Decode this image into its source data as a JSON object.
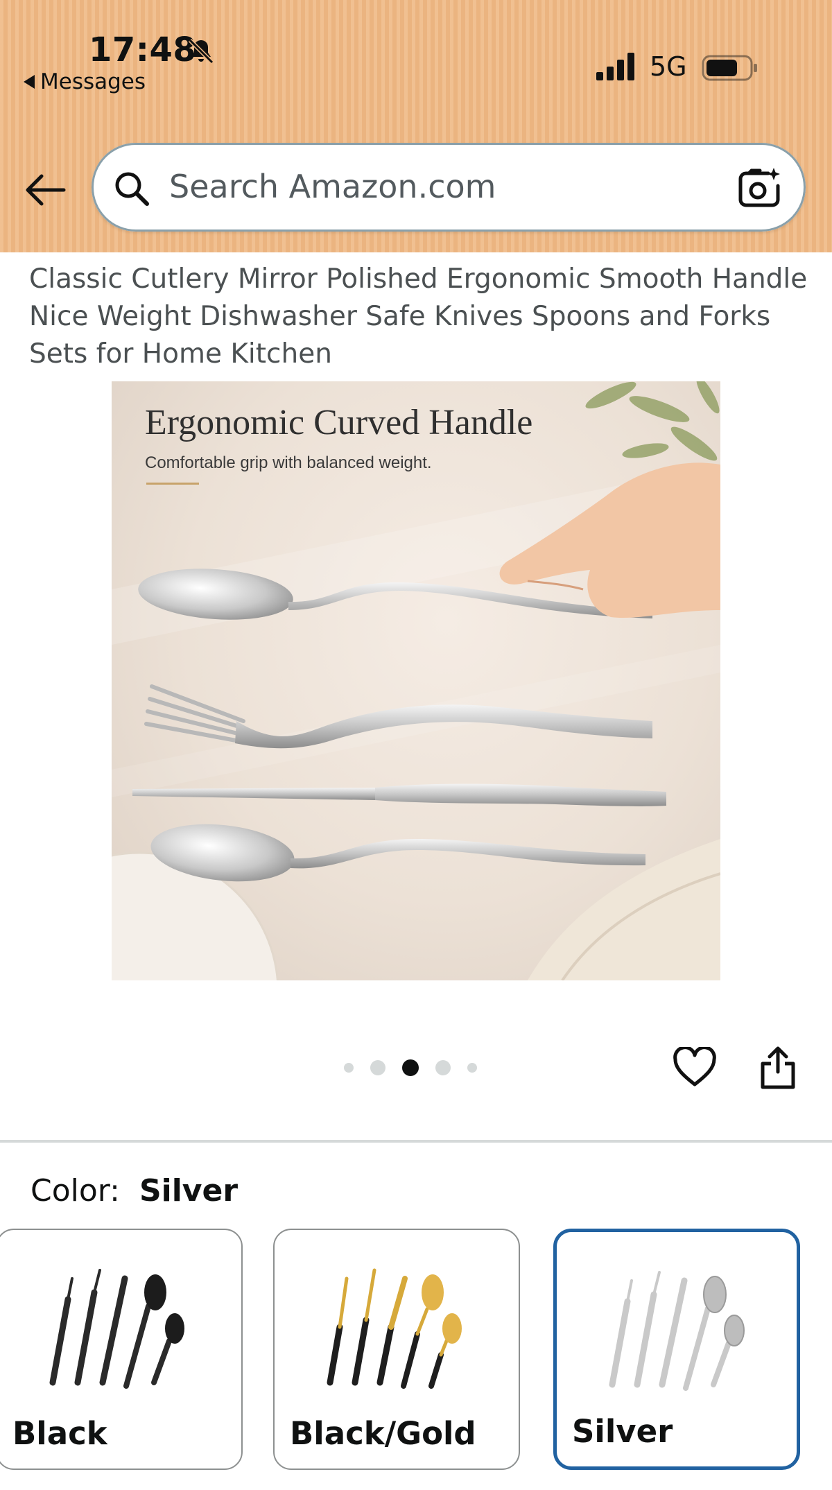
{
  "status_bar": {
    "time": "17:48",
    "back_app_label": "Messages",
    "network": "5G"
  },
  "search": {
    "placeholder": "Search Amazon.com"
  },
  "product": {
    "title": "Classic Cutlery Mirror Polished Ergonomic Smooth Handle Nice Weight Dishwasher Safe Knives Spoons and Forks Sets for Home Kitchen",
    "image": {
      "headline": "Ergonomic Curved Handle",
      "subline": "Comfortable grip with balanced weight."
    },
    "carousel": {
      "count": 5,
      "active_index": 2
    }
  },
  "color": {
    "label": "Color:",
    "selected": "Silver",
    "options": [
      {
        "label": "Black",
        "selected": false
      },
      {
        "label": "Black/Gold",
        "selected": false
      },
      {
        "label": "Silver",
        "selected": true
      }
    ]
  },
  "colors": {
    "header_bg": "#efb985",
    "selected_border": "#2162a1",
    "text": "#0f1111",
    "title_text": "#4b5052"
  },
  "icons": [
    "bell-slash-icon",
    "signal-icon",
    "battery-icon",
    "back-arrow-icon",
    "search-icon",
    "camera-icon",
    "heart-icon",
    "share-icon"
  ]
}
